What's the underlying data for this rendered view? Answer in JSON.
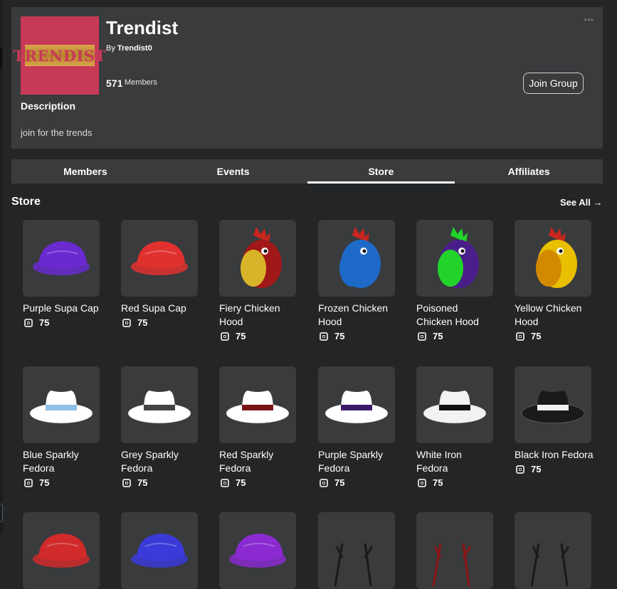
{
  "group": {
    "emblem_text": "TRENDIST",
    "name": "Trendist",
    "by_prefix": "By",
    "owner": "Trendist0",
    "members_count": "571",
    "members_label": "Members",
    "join_label": "Join Group",
    "more_label": "▫▫▫",
    "description_title": "Description",
    "description": "join for the trends"
  },
  "tabs": [
    {
      "label": "Members",
      "active": false
    },
    {
      "label": "Events",
      "active": false
    },
    {
      "label": "Store",
      "active": true
    },
    {
      "label": "Affiliates",
      "active": false
    }
  ],
  "store": {
    "title": "Store",
    "see_all": "See All →",
    "items": [
      {
        "name": "Purple Supa Cap",
        "price": "75",
        "kind": "cap",
        "color": "#6a2ad0"
      },
      {
        "name": "Red Supa Cap",
        "price": "75",
        "kind": "cap",
        "color": "#e0312e"
      },
      {
        "name": "Fiery Chicken Hood",
        "price": "75",
        "kind": "chicken",
        "color": "#a01818",
        "beak": "#d8b428"
      },
      {
        "name": "Frozen Chicken Hood",
        "price": "75",
        "kind": "chicken",
        "color": "#1e6ac8",
        "beak": "#1e6ac8"
      },
      {
        "name": "Poisoned Chicken Hood",
        "price": "75",
        "kind": "chicken",
        "color": "#4a1e8a",
        "beak": "#22d42a"
      },
      {
        "name": "Yellow Chicken Hood",
        "price": "75",
        "kind": "chicken",
        "color": "#e8c000",
        "beak": "#d48a00"
      },
      {
        "name": "Blue Sparkly Fedora",
        "price": "75",
        "kind": "fedora",
        "color": "#ffffff",
        "band": "#8ec0e8"
      },
      {
        "name": "Grey Sparkly Fedora",
        "price": "75",
        "kind": "fedora",
        "color": "#ffffff",
        "band": "#444444"
      },
      {
        "name": "Red Sparkly Fedora",
        "price": "75",
        "kind": "fedora",
        "color": "#ffffff",
        "band": "#7a1418"
      },
      {
        "name": "Purple Sparkly Fedora",
        "price": "75",
        "kind": "fedora",
        "color": "#ffffff",
        "band": "#3a1a6a"
      },
      {
        "name": "White Iron Fedora",
        "price": "75",
        "kind": "fedora",
        "color": "#f2f2f2",
        "band": "#111111"
      },
      {
        "name": "Black Iron Fedora",
        "price": "75",
        "kind": "fedora",
        "color": "#1a1a1a",
        "band": "#f2f2f2"
      },
      {
        "name": "",
        "price": "",
        "kind": "cap",
        "color": "#d02a2a"
      },
      {
        "name": "",
        "price": "",
        "kind": "cap",
        "color": "#3a3ad8"
      },
      {
        "name": "",
        "price": "",
        "kind": "cap",
        "color": "#8a2ad0"
      },
      {
        "name": "",
        "price": "",
        "kind": "antlers",
        "color": "#1a1a1a"
      },
      {
        "name": "",
        "price": "",
        "kind": "antlers",
        "color": "#8a1414"
      },
      {
        "name": "",
        "price": "",
        "kind": "antlers",
        "color": "#1a1a1a"
      }
    ]
  }
}
